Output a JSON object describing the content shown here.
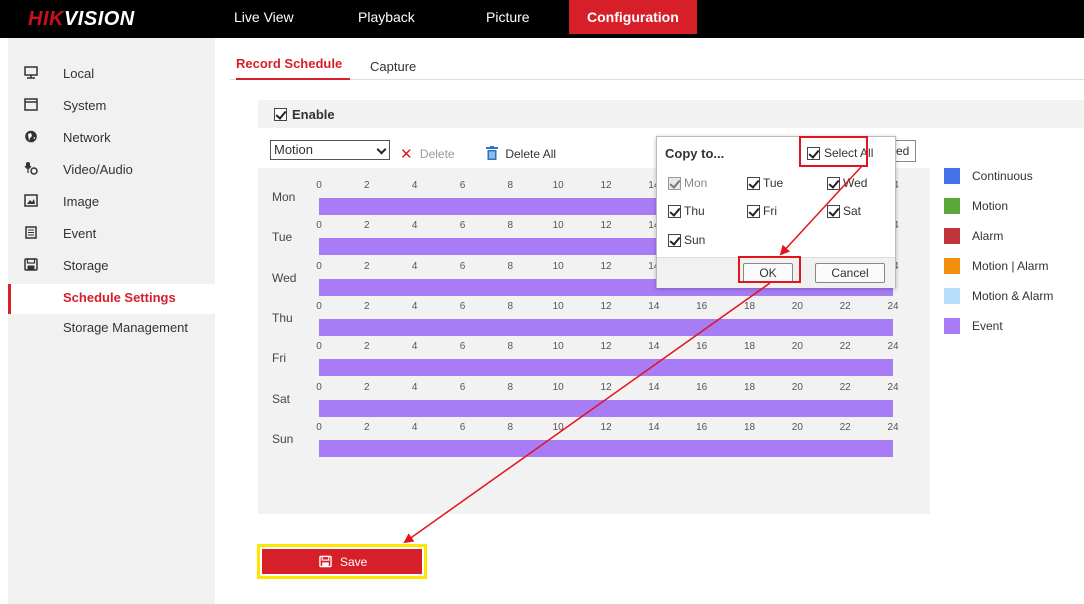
{
  "brand": {
    "logo_hik": "HIK",
    "logo_vision": "VISION"
  },
  "nav": {
    "tabs": [
      "Live View",
      "Playback",
      "Picture",
      "Configuration"
    ]
  },
  "sidebar": {
    "items": [
      {
        "label": "Local",
        "icon": "monitor-icon"
      },
      {
        "label": "System",
        "icon": "window-icon"
      },
      {
        "label": "Network",
        "icon": "globe-icon"
      },
      {
        "label": "Video/Audio",
        "icon": "camera-mic-icon"
      },
      {
        "label": "Image",
        "icon": "image-icon"
      },
      {
        "label": "Event",
        "icon": "calendar-icon"
      },
      {
        "label": "Storage",
        "icon": "floppy-icon"
      }
    ],
    "sub_items": [
      "Schedule Settings",
      "Storage Management"
    ]
  },
  "subtabs": [
    "Record Schedule",
    "Capture"
  ],
  "schedule": {
    "enable_label": "Enable",
    "type_selected": "Motion",
    "delete_label": "Delete",
    "delete_all_label": "Delete All",
    "overflow_text": "ed",
    "days": [
      "Mon",
      "Tue",
      "Wed",
      "Thu",
      "Fri",
      "Sat",
      "Sun"
    ],
    "ticks": [
      "0",
      "2",
      "4",
      "6",
      "8",
      "10",
      "12",
      "14",
      "16",
      "18",
      "20",
      "22",
      "24"
    ],
    "save_label": "Save"
  },
  "copy_dialog": {
    "title": "Copy to...",
    "select_all_label": "Select All",
    "days": [
      {
        "label": "Mon",
        "checked": true,
        "disabled": true
      },
      {
        "label": "Tue",
        "checked": true
      },
      {
        "label": "Wed",
        "checked": true
      },
      {
        "label": "Thu",
        "checked": true
      },
      {
        "label": "Fri",
        "checked": true
      },
      {
        "label": "Sat",
        "checked": true
      },
      {
        "label": "Sun",
        "checked": true
      }
    ],
    "ok_label": "OK",
    "cancel_label": "Cancel"
  },
  "legend": [
    {
      "label": "Continuous",
      "color": "#4472e8"
    },
    {
      "label": "Motion",
      "color": "#5aa83c"
    },
    {
      "label": "Alarm",
      "color": "#c0353a"
    },
    {
      "label": "Motion | Alarm",
      "color": "#f0900c"
    },
    {
      "label": "Motion & Alarm",
      "color": "#b7def8"
    },
    {
      "label": "Event",
      "color": "#a77cf5"
    }
  ],
  "colors": {
    "accent": "#d71f2a",
    "event_bar": "#a77cf5",
    "highlight": "#ffe600"
  }
}
